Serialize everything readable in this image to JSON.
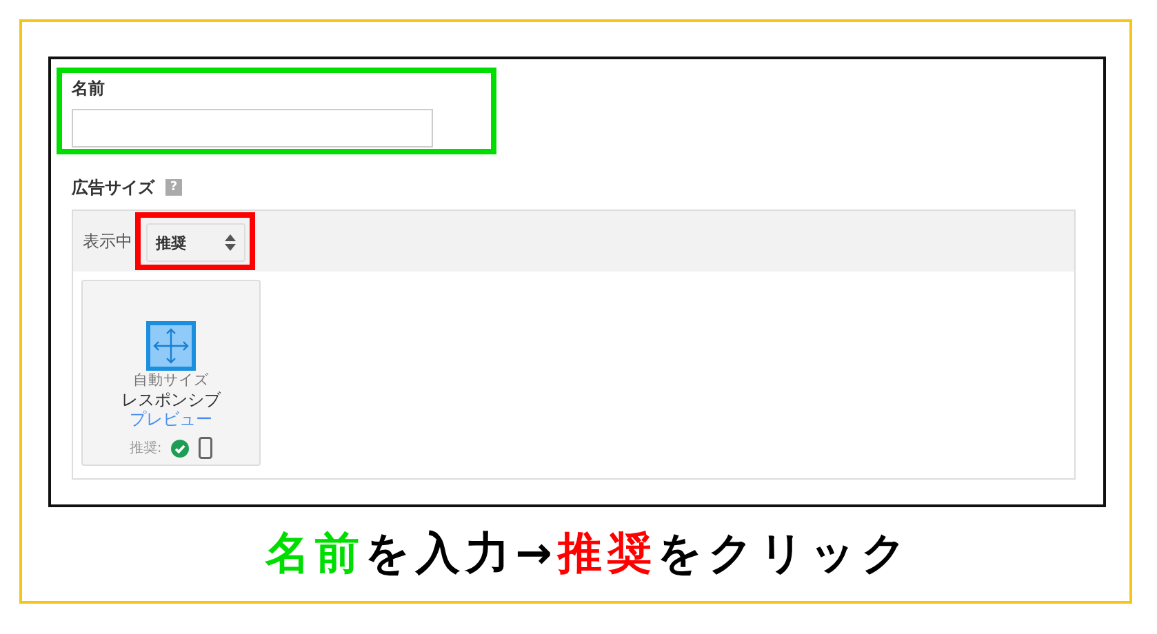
{
  "highlights": [
    {
      "color": "#00dd00"
    },
    {
      "color": "#ff0000"
    }
  ],
  "name_section": {
    "label": "名前"
  },
  "ad_size": {
    "label": "広告サイズ",
    "help_icon": "?",
    "filter": {
      "label": "表示中",
      "select": {
        "value": "推奨"
      }
    },
    "cards": [
      {
        "caption": "自動サイズ",
        "title": "レスポンシブ",
        "link": "プレビュー",
        "recommended_label": "推奨:",
        "recommended": true
      }
    ]
  },
  "instruction": [
    {
      "text": "名前",
      "color": "#00dd00"
    },
    {
      "text": "を入力→",
      "color": "#000000"
    },
    {
      "text": "推奨",
      "color": "#ff0000"
    },
    {
      "text": "をクリック",
      "color": "#000000"
    }
  ]
}
